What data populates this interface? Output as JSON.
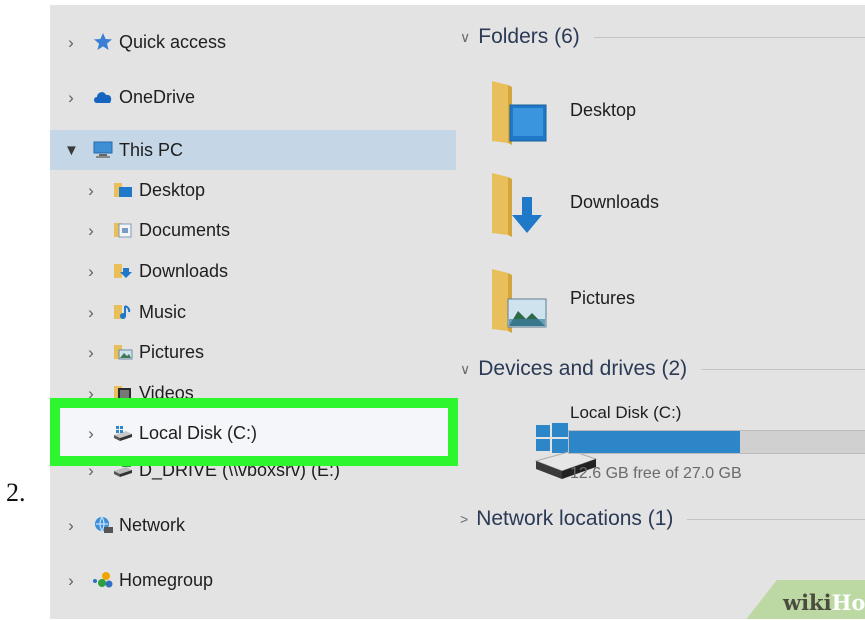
{
  "step_number": "2.",
  "nav": {
    "quick_access": "Quick access",
    "onedrive": "OneDrive",
    "this_pc": "This PC",
    "desktop": "Desktop",
    "documents": "Documents",
    "downloads": "Downloads",
    "music": "Music",
    "pictures": "Pictures",
    "videos": "Videos",
    "local_disk": "Local Disk (C:)",
    "d_drive": "D_DRIVE (\\\\vboxsrv) (E:)",
    "network": "Network",
    "homegroup": "Homegroup"
  },
  "content": {
    "folders_header": "Folders (6)",
    "folders": [
      "Desktop",
      "Downloads",
      "Pictures"
    ],
    "devices_header": "Devices and drives (2)",
    "drive": {
      "name": "Local Disk (C:)",
      "free_text": "12.6 GB free of 27.0 GB",
      "used_fraction": 0.533
    },
    "network_header": "Network locations (1)"
  },
  "watermark": {
    "part1": "wiki",
    "part2": "How"
  },
  "colors": {
    "highlight": "#2ef62e",
    "selected": "#c5d6e6",
    "drive_bar": "#2d86c8",
    "folder": "#e8bf5a"
  }
}
